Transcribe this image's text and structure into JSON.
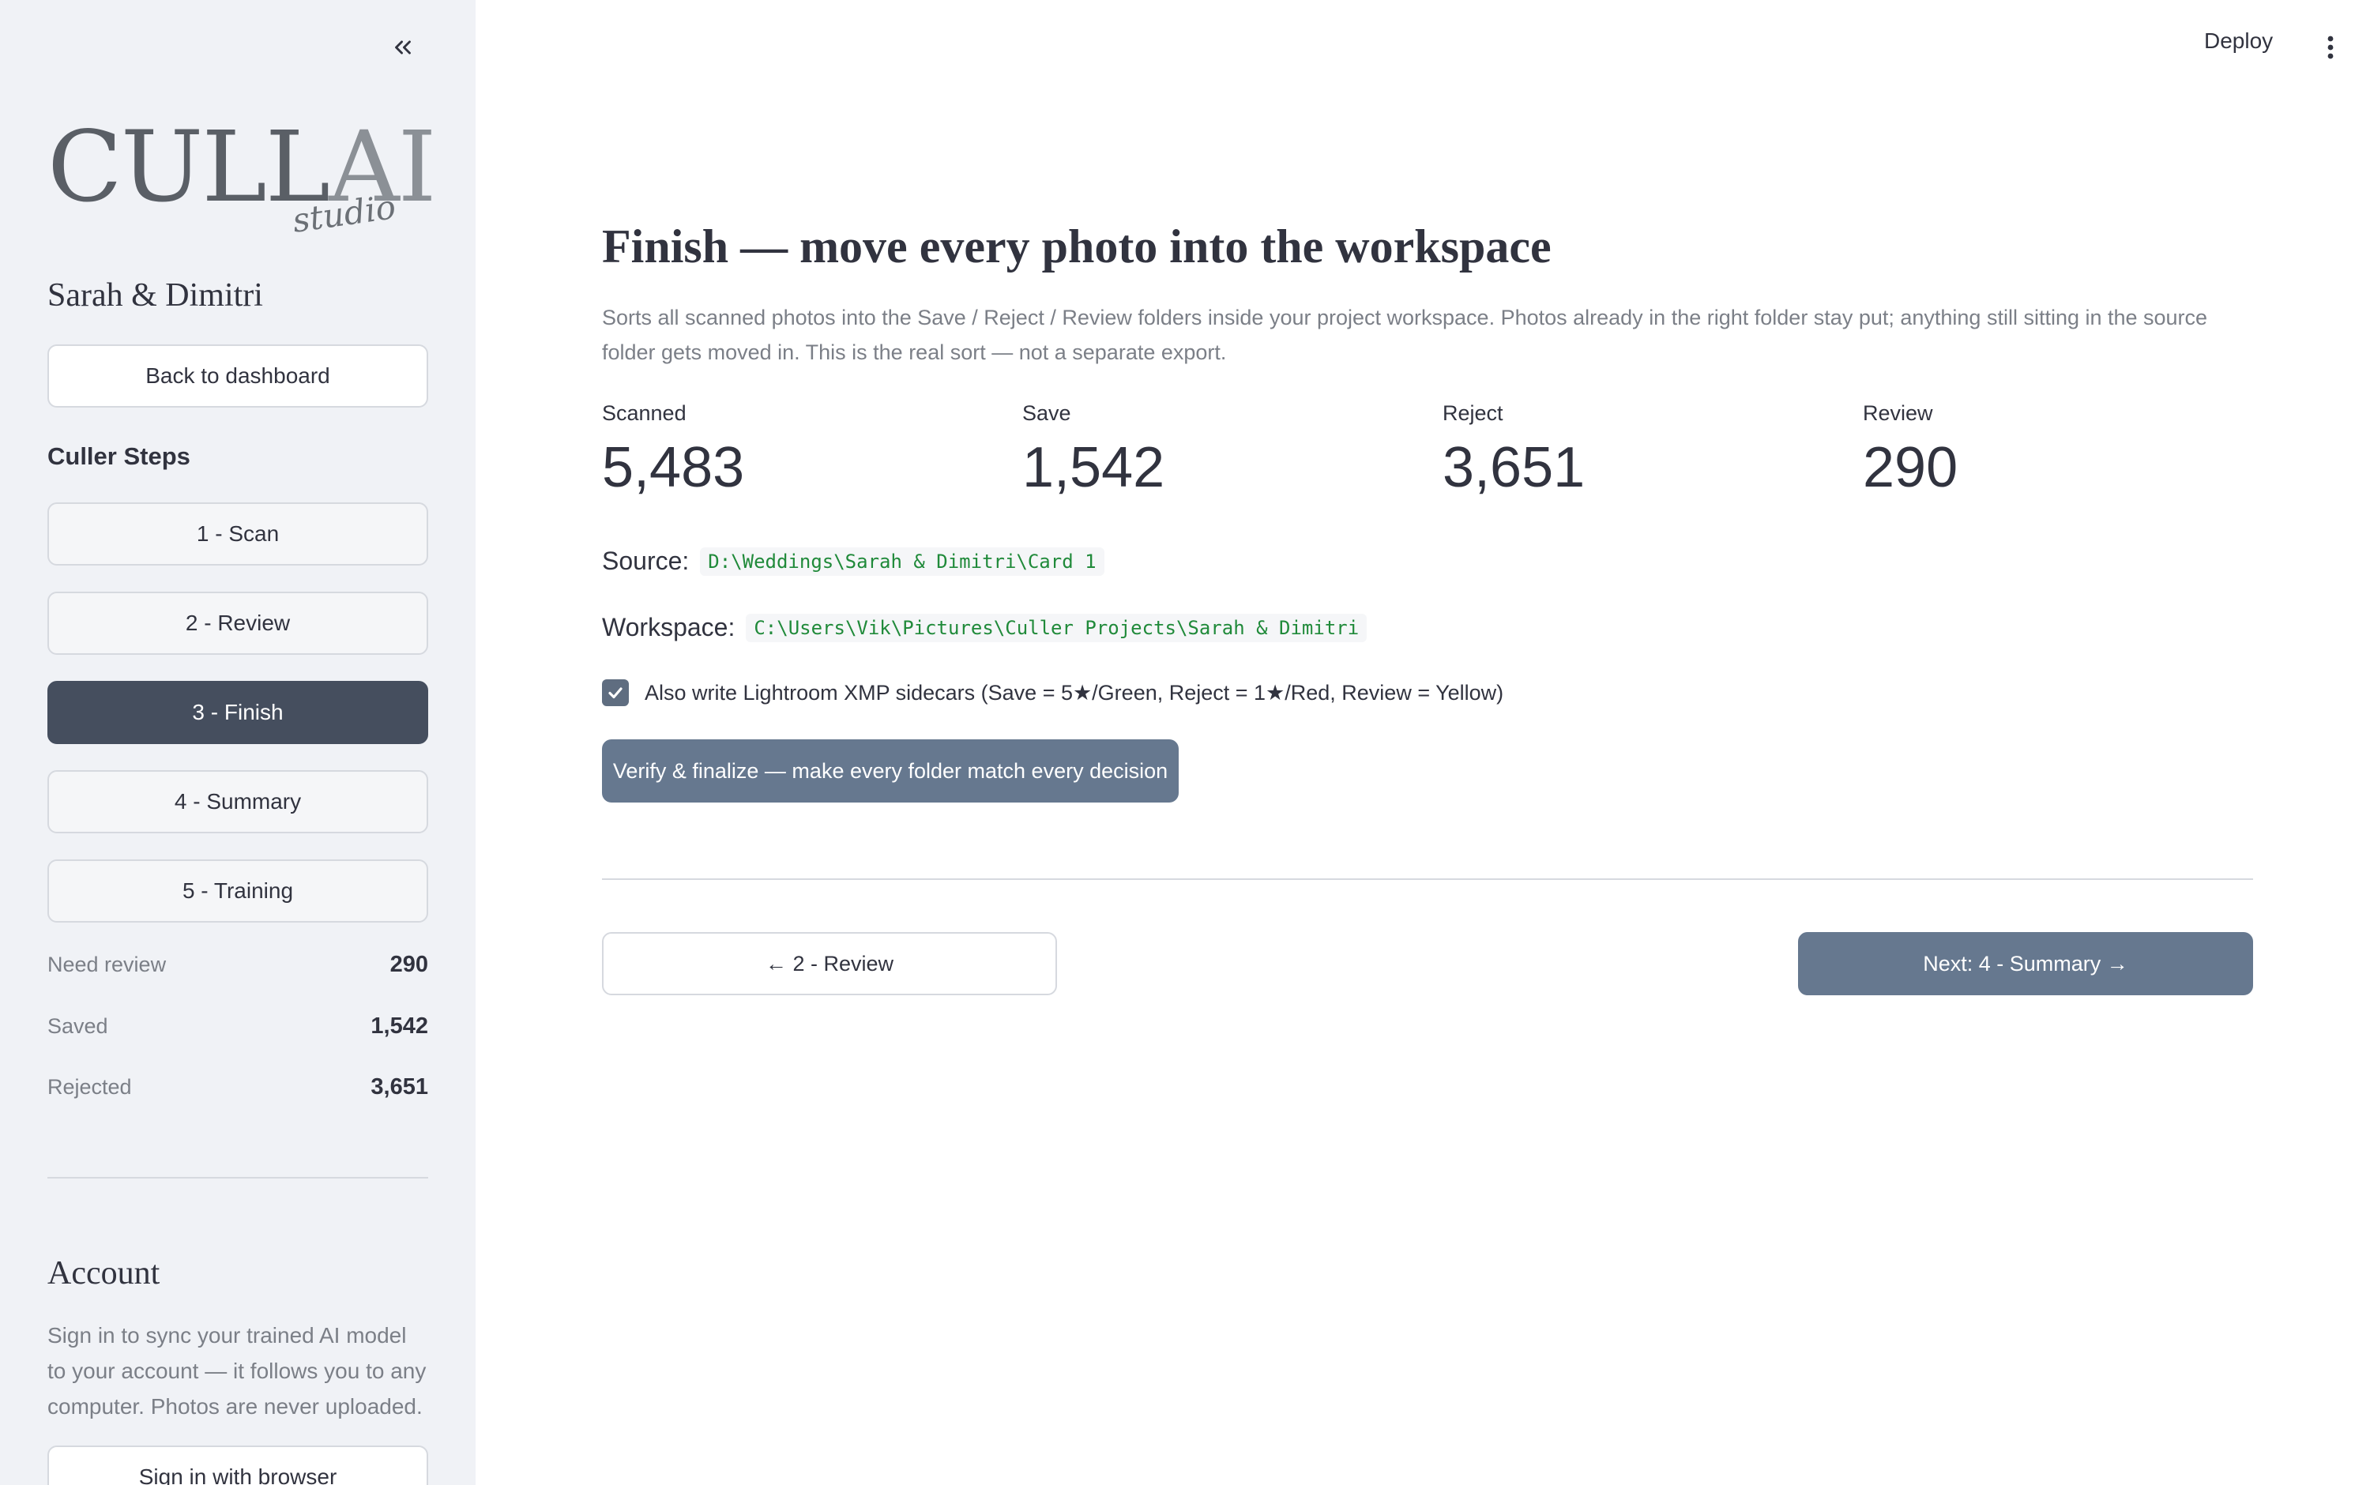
{
  "header": {
    "deploy_label": "Deploy"
  },
  "sidebar": {
    "logo": {
      "main": "CULLAI",
      "main_bold": "CULL",
      "main_light": "AI",
      "sub": "studio"
    },
    "project_name": "Sarah & Dimitri",
    "back_label": "Back to dashboard",
    "steps_title": "Culler Steps",
    "steps": [
      {
        "label": "1 - Scan",
        "active": false
      },
      {
        "label": "2 - Review",
        "active": false
      },
      {
        "label": "3 - Finish",
        "active": true
      },
      {
        "label": "4 - Summary",
        "active": false
      },
      {
        "label": "5 - Training",
        "active": false
      }
    ],
    "stats": [
      {
        "label": "Need review",
        "value": "290"
      },
      {
        "label": "Saved",
        "value": "1,542"
      },
      {
        "label": "Rejected",
        "value": "3,651"
      }
    ],
    "account": {
      "title": "Account",
      "text": "Sign in to sync your trained AI model to your account — it follows you to any computer. Photos are never uploaded.",
      "sign_in_label": "Sign in with browser"
    }
  },
  "main": {
    "title": "Finish — move every photo into the workspace",
    "description": "Sorts all scanned photos into the Save / Reject / Review folders inside your project workspace. Photos already in the right folder stay put; anything still sitting in the source folder gets moved in. This is the real sort — not a separate export.",
    "metrics": [
      {
        "label": "Scanned",
        "value": "5,483"
      },
      {
        "label": "Save",
        "value": "1,542"
      },
      {
        "label": "Reject",
        "value": "3,651"
      },
      {
        "label": "Review",
        "value": "290"
      }
    ],
    "source": {
      "label": "Source:",
      "path": "D:\\Weddings\\Sarah & Dimitri\\Card 1"
    },
    "workspace": {
      "label": "Workspace:",
      "path": "C:\\Users\\Vik\\Pictures\\Culler Projects\\Sarah & Dimitri"
    },
    "xmp_checkbox": {
      "label": "Also write Lightroom XMP sidecars (Save = 5★/Green, Reject = 1★/Red, Review = Yellow)",
      "checked": true
    },
    "finalize_label": "Verify & finalize — make every folder match every decision",
    "prev_label": "← 2 - Review",
    "next_label": "Next: 4 - Summary →"
  },
  "colors": {
    "sidebar_bg": "#f0f2f6",
    "active_step": "#454e5e",
    "primary_button": "#66788f",
    "code_text": "#208a3a"
  }
}
